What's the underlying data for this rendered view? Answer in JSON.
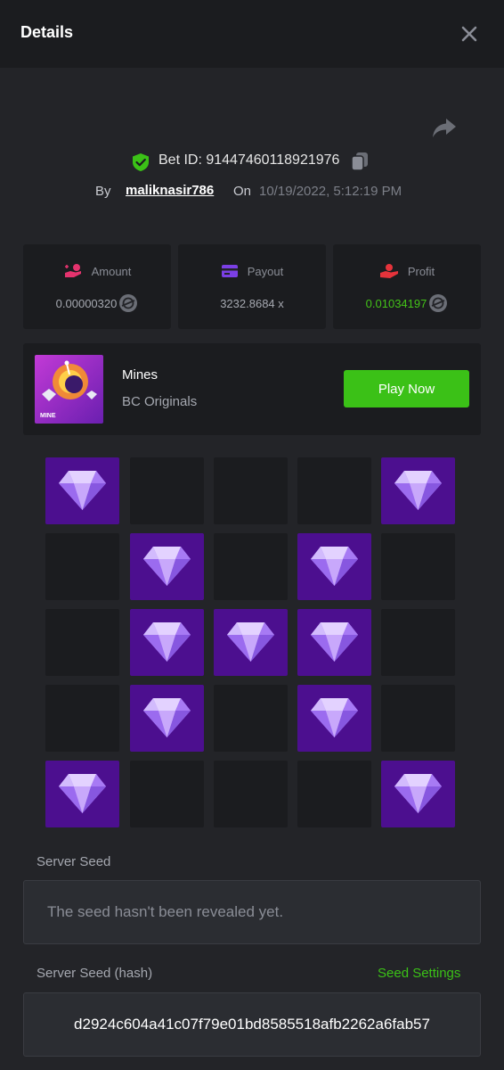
{
  "header": {
    "title": "Details"
  },
  "bet": {
    "id_text": "Bet ID: 91447460118921976",
    "by_label": "By",
    "username": "maliknasir786",
    "on_label": "On",
    "date": "10/19/2022, 5:12:19 PM"
  },
  "stats": {
    "amount": {
      "label": "Amount",
      "value": "0.00000320"
    },
    "payout": {
      "label": "Payout",
      "value": "3232.8684 x"
    },
    "profit": {
      "label": "Profit",
      "value": "0.01034197"
    }
  },
  "game": {
    "name": "Mines",
    "provider": "BC Originals",
    "thumb_label": "MINE",
    "play_label": "Play Now"
  },
  "board": {
    "rows": [
      [
        "gem",
        "empty",
        "empty",
        "empty",
        "gem"
      ],
      [
        "empty",
        "gem",
        "empty",
        "gem",
        "empty"
      ],
      [
        "empty",
        "gem",
        "gem",
        "gem",
        "empty"
      ],
      [
        "empty",
        "gem",
        "empty",
        "gem",
        "empty"
      ],
      [
        "gem",
        "empty",
        "empty",
        "empty",
        "gem"
      ]
    ]
  },
  "server_seed": {
    "label": "Server Seed",
    "value": "The seed hasn't been revealed yet."
  },
  "server_seed_hash": {
    "label": "Server Seed (hash)",
    "settings_label": "Seed Settings",
    "value": "d2924c604a41c07f79e01bd8585518afb2262a6fab57"
  },
  "colors": {
    "accent_green": "#3bc117",
    "gem_tile": "#4c0f8f",
    "empty_tile": "#1b1c1f",
    "background": "#232428"
  },
  "icons": [
    "close-icon",
    "share-icon",
    "shield-check-icon",
    "copy-icon",
    "amount-icon",
    "payout-icon",
    "profit-icon",
    "coin-icon",
    "gem-icon"
  ]
}
